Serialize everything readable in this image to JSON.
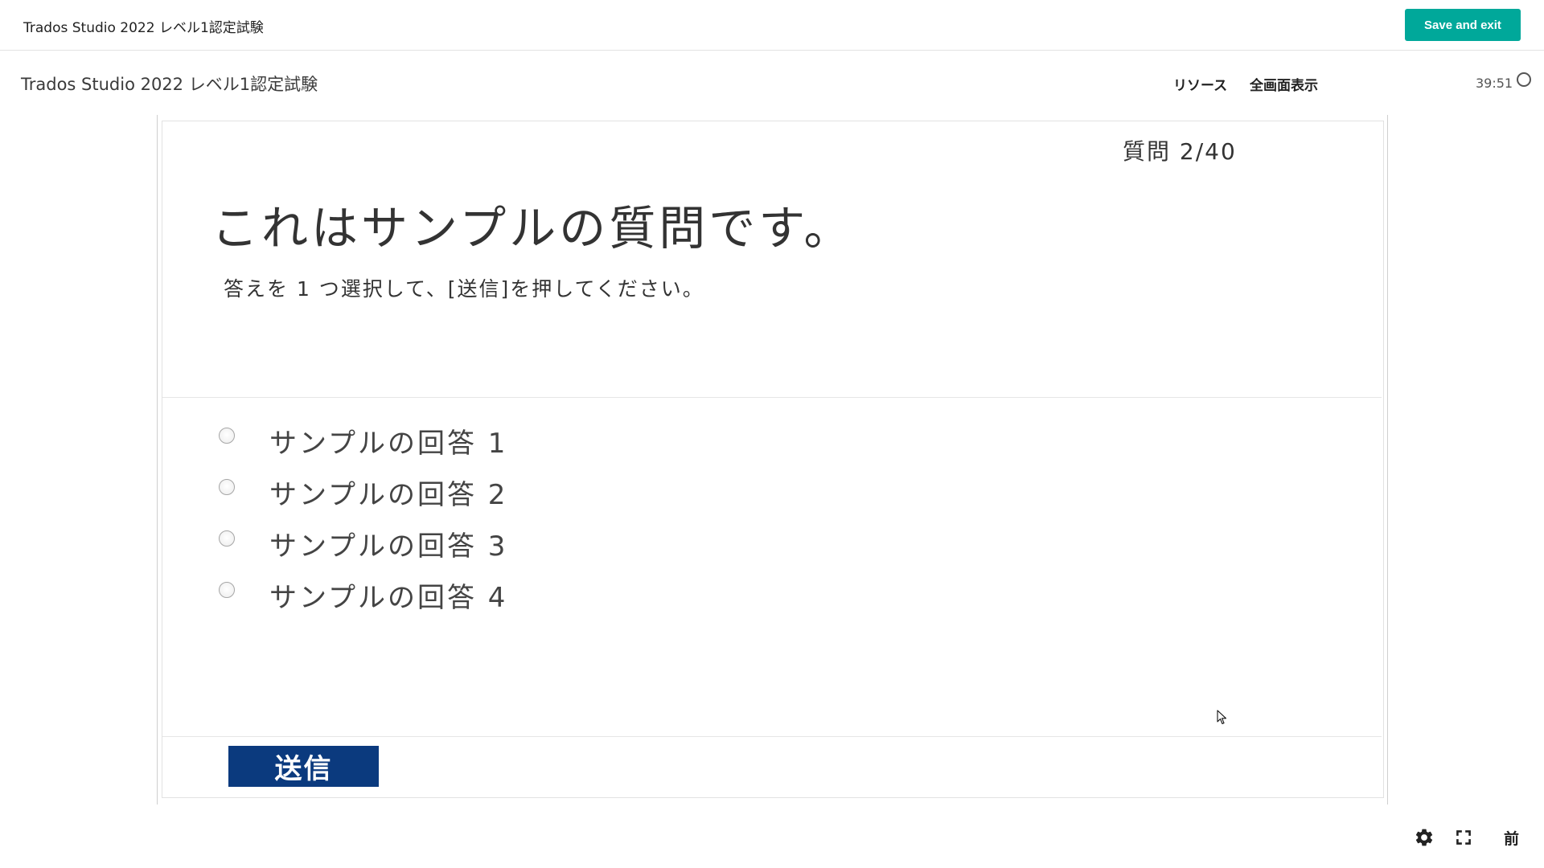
{
  "header": {
    "app_title": "Trados Studio 2022 レベル1認定試験",
    "save_exit_label": "Save and exit"
  },
  "subheader": {
    "course_title": "Trados Studio 2022 レベル1認定試験",
    "resources_label": "リソース",
    "fullscreen_label": "全画面表示",
    "timer": "39:51"
  },
  "slide": {
    "question_counter": "質問 2/40",
    "question_title": "これはサンプルの質問です。",
    "instruction": "答えを 1 つ選択して、[送信]を押してください。",
    "answers": [
      {
        "label": "サンプルの回答 1",
        "selected": false
      },
      {
        "label": "サンプルの回答 2",
        "selected": false
      },
      {
        "label": "サンプルの回答 3",
        "selected": false
      },
      {
        "label": "サンプルの回答 4",
        "selected": false
      }
    ],
    "submit_label": "送信"
  },
  "footer": {
    "settings_icon": "gear-icon",
    "fullscreen_icon": "expand-icon",
    "prev_label": "前"
  },
  "colors": {
    "accent": "#00a89a",
    "submit_bg": "#0b3a7e"
  }
}
